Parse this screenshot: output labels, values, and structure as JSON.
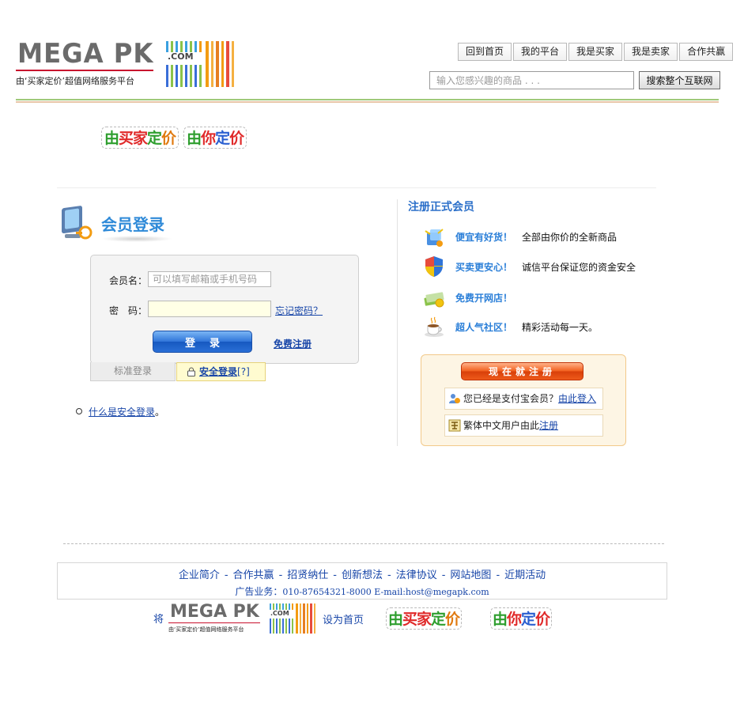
{
  "brand": {
    "name": "MEGA PK",
    "domain": ".COM",
    "tagline": "由‘买家定价’超值网络服务平台"
  },
  "topnav": {
    "items": [
      "回到首页",
      "我的平台",
      "我是买家",
      "我是卖家",
      "合作共赢"
    ]
  },
  "search": {
    "placeholder": "输入您感兴趣的商品 . . .",
    "button": "搜索整个互联网"
  },
  "slogan": {
    "badge1": [
      "由",
      "买家",
      "定",
      "价"
    ],
    "badge2": [
      "由",
      "你",
      "定",
      "价"
    ]
  },
  "login": {
    "title": "会员登录",
    "username_label": "会员名：",
    "username_placeholder": "可以填写邮箱或手机号码",
    "password_label": "密　码：",
    "forgot": "忘记密码？",
    "submit": "登录",
    "free_register": "免费注册",
    "tab_standard": "标准登录",
    "tab_secure": "安全登录",
    "tab_secure_help": "[?]",
    "help_link": "什么是安全登录",
    "help_suffix": "。"
  },
  "register": {
    "title": "注册正式会员",
    "features": [
      {
        "icon": "shopping-bag-icon",
        "head": "便宜有好货！",
        "desc": "全部由你价的全新商品"
      },
      {
        "icon": "shield-icon",
        "head": "买卖更安心！",
        "desc": "诚信平台保证您的资金安全"
      },
      {
        "icon": "money-stack-icon",
        "head": "免费开网店！",
        "desc": ""
      },
      {
        "icon": "coffee-cup-icon",
        "head": "超人气社区！",
        "desc": "精彩活动每一天。"
      }
    ],
    "button": "现在就注册",
    "alipay_text": "您已经是支付宝会员？",
    "alipay_link": "由此登入",
    "trad_text": "繁体中文用户由此",
    "trad_link": "注册"
  },
  "footer": {
    "links": [
      "企业简介",
      "合作共赢",
      "招贤纳仕",
      "创新想法",
      "法律协议",
      "网站地图",
      "近期活动"
    ],
    "contact_label": "广告业务：",
    "contact_value": "010-87654321-8000 E-mail:host@megapk.com",
    "jiang": "将",
    "set_home": "设为首页"
  },
  "colors": {
    "link": "#1846a8",
    "accent_blue": "#2f8ad8",
    "brand_red": "#c8102e",
    "register_orange": "#ee5a1a"
  }
}
